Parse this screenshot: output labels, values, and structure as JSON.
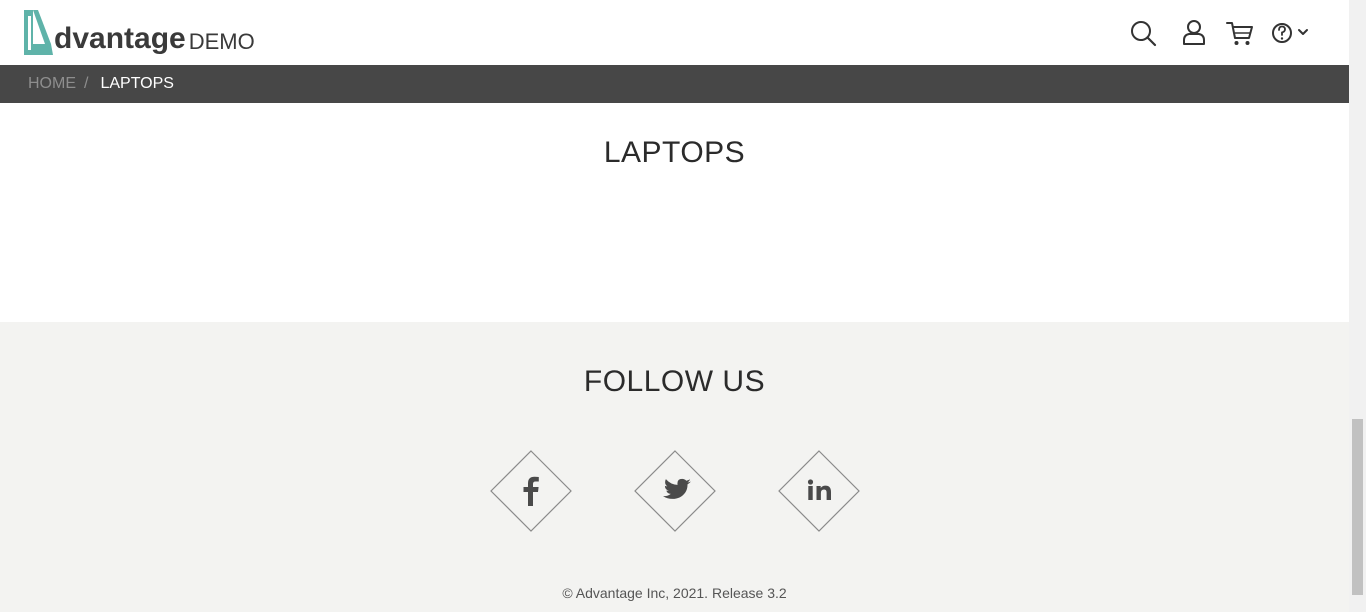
{
  "header": {
    "logo_word": "dvantage",
    "logo_suffix": "DEMO",
    "icons": [
      "search-icon",
      "user-icon",
      "cart-icon",
      "help-icon"
    ],
    "accent_color": "#5fb3a9"
  },
  "breadcrumb": {
    "home": "HOME",
    "separator": "/",
    "current": "LAPTOPS"
  },
  "main": {
    "title": "LAPTOPS"
  },
  "footer": {
    "follow_title": "FOLLOW US",
    "social": [
      "facebook-icon",
      "twitter-icon",
      "linkedin-icon"
    ],
    "copyright": "© Advantage Inc, 2021. Release 3.2"
  }
}
